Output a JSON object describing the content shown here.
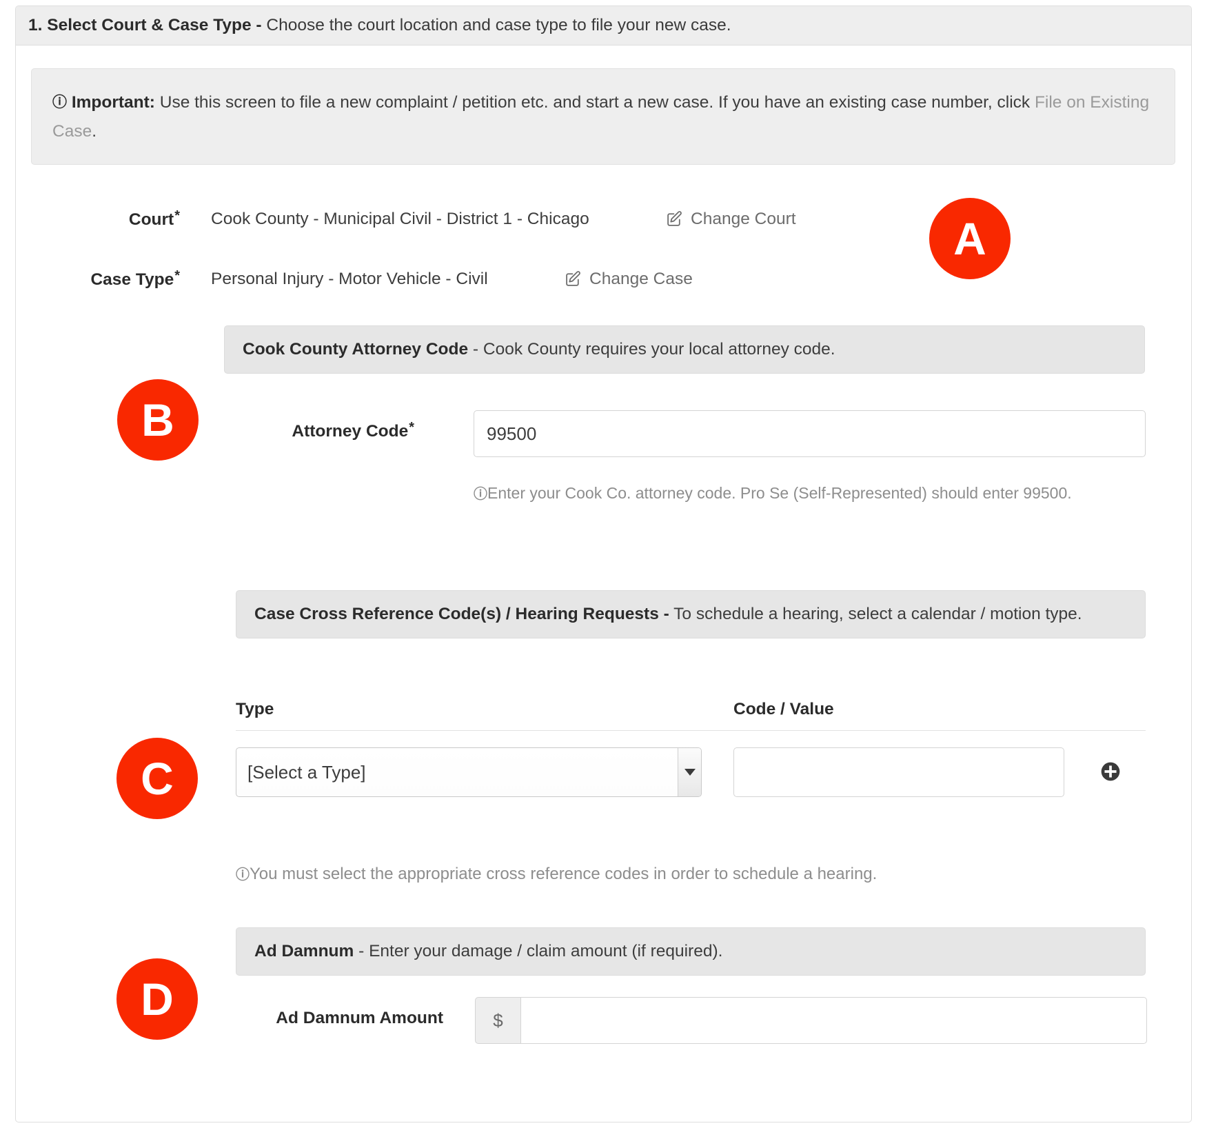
{
  "step": {
    "title_bold": "1. Select Court & Case Type -",
    "title_rest": " Choose the court location and case type to file your new case."
  },
  "alert": {
    "icon": "info-icon",
    "label_bold": "Important:",
    "text_1": " Use this screen to file a new complaint / petition etc. and start a new case. If you have an existing case number, click ",
    "link_text": "File on Existing Case",
    "text_2": "."
  },
  "court": {
    "label": "Court",
    "required_mark": "*",
    "value": "Cook County - Municipal Civil - District 1 - Chicago",
    "change_label": "Change Court",
    "change_icon": "edit-pencil-icon"
  },
  "case_type": {
    "label": "Case Type",
    "required_mark": "*",
    "value": "Personal Injury - Motor Vehicle - Civil",
    "change_label": "Change Case",
    "change_icon": "edit-pencil-icon"
  },
  "attorney_code_section": {
    "header_bold": "Cook County Attorney Code",
    "header_rest": " - Cook County requires your local attorney code.",
    "field_label": "Attorney Code",
    "required_mark": "*",
    "value": "99500",
    "placeholder": "",
    "help": "Enter your Cook Co. attorney code. Pro Se (Self-Represented) should enter 99500."
  },
  "cross_reference_section": {
    "header_bold": "Case Cross Reference Code(s) / Hearing Requests -",
    "header_rest": " To schedule a hearing, select a calendar / motion type.",
    "columns": [
      "Type",
      "Code / Value"
    ],
    "type_selected": "[Select a Type]",
    "type_options": [
      "[Select a Type]"
    ],
    "code_value": "",
    "code_value_placeholder": "",
    "add_icon": "plus-circle-icon",
    "help": "You must select the appropriate cross reference codes in order to schedule a hearing."
  },
  "ad_damnum_section": {
    "header_bold": "Ad Damnum",
    "header_rest": " - Enter your damage / claim amount (if required).",
    "field_label": "Ad Damnum Amount",
    "currency_symbol": "$",
    "value": "",
    "placeholder": ""
  },
  "annotations": [
    {
      "letter": "A",
      "color": "#f92800"
    },
    {
      "letter": "B",
      "color": "#f92800"
    },
    {
      "letter": "C",
      "color": "#f92800"
    },
    {
      "letter": "D",
      "color": "#f92800"
    }
  ]
}
